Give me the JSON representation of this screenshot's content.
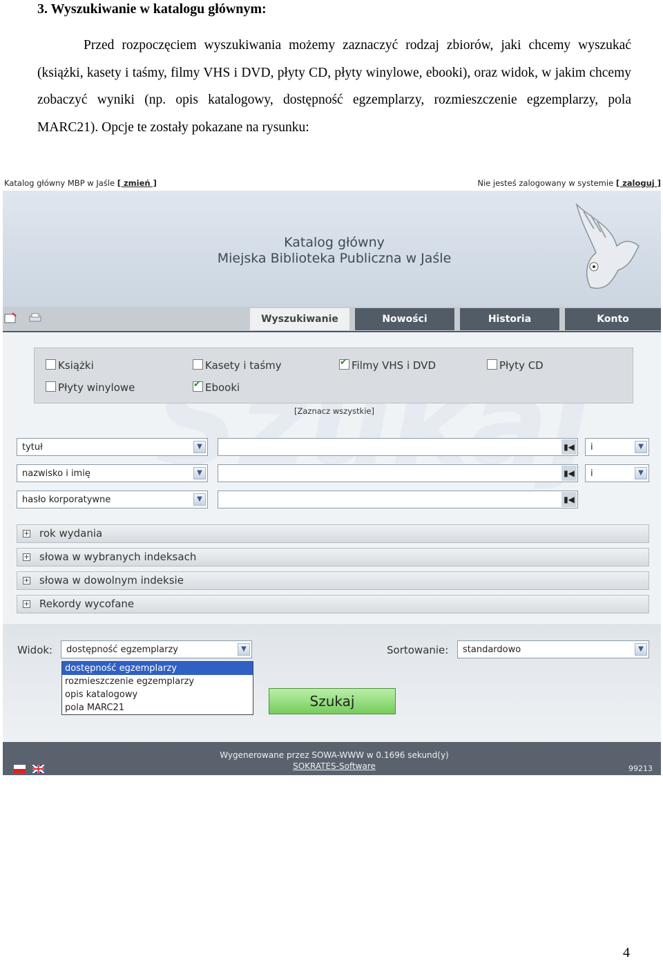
{
  "doc": {
    "heading": "3. Wyszukiwanie w katalogu głównym:",
    "paragraph": "Przed rozpoczęciem wyszukiwania możemy zaznaczyć rodzaj zbiorów, jaki chcemy wyszukać (książki, kasety i taśmy, filmy VHS i DVD, płyty CD, płyty winylowe, ebooki), oraz widok, w jakim chcemy zobaczyć wyniki (np. opis katalogowy, dostępność egzemplarzy, rozmieszczenie egzemplarzy, pola MARC21). Opcje te zostały pokazane na rysunku:",
    "page_number": "4"
  },
  "app": {
    "topbar": {
      "catalog": "Katalog główny MBP w Jaśle",
      "change_link": "[ zmień ]",
      "status": "Nie jesteś zalogowany w systemie",
      "login_link": "[ zaloguj ]"
    },
    "banner": {
      "line1": "Katalog główny",
      "line2": "Miejska Biblioteka Publiczna w Jaśle"
    },
    "tabs": [
      "Wyszukiwanie",
      "Nowości",
      "Historia",
      "Konto"
    ],
    "watermark": "Szukaj",
    "collection_types": [
      {
        "label": "Książki",
        "checked": false
      },
      {
        "label": "Kasety i taśmy",
        "checked": false
      },
      {
        "label": "Filmy VHS i DVD",
        "checked": true
      },
      {
        "label": "Płyty CD",
        "checked": false
      },
      {
        "label": "Płyty winylowe",
        "checked": false
      },
      {
        "label": "Ebooki",
        "checked": true
      }
    ],
    "mark_all": "[Zaznacz wszystkie]",
    "search_rows": [
      {
        "field": "tytuł",
        "value": "",
        "operator": "i"
      },
      {
        "field": "nazwisko i imię",
        "value": "",
        "operator": "i"
      },
      {
        "field": "hasło korporatywne",
        "value": ""
      }
    ],
    "expand_sections": [
      "rok wydania",
      "słowa w wybranych indeksach",
      "słowa w dowolnym indeksie",
      "Rekordy wycofane"
    ],
    "view": {
      "label": "Widok:",
      "selected": "dostępność egzemplarzy",
      "options": [
        "dostępność egzemplarzy",
        "rozmieszczenie egzemplarzy",
        "opis katalogowy",
        "pola MARC21"
      ]
    },
    "sort": {
      "label": "Sortowanie:",
      "selected": "standardowo"
    },
    "search_button": "Szukaj",
    "footer": {
      "generated": "Wygenerowane przez SOWA-WWW w 0.1696 sekund(y)",
      "vendor": "SOKRATES-Software",
      "counter": "99213"
    }
  }
}
